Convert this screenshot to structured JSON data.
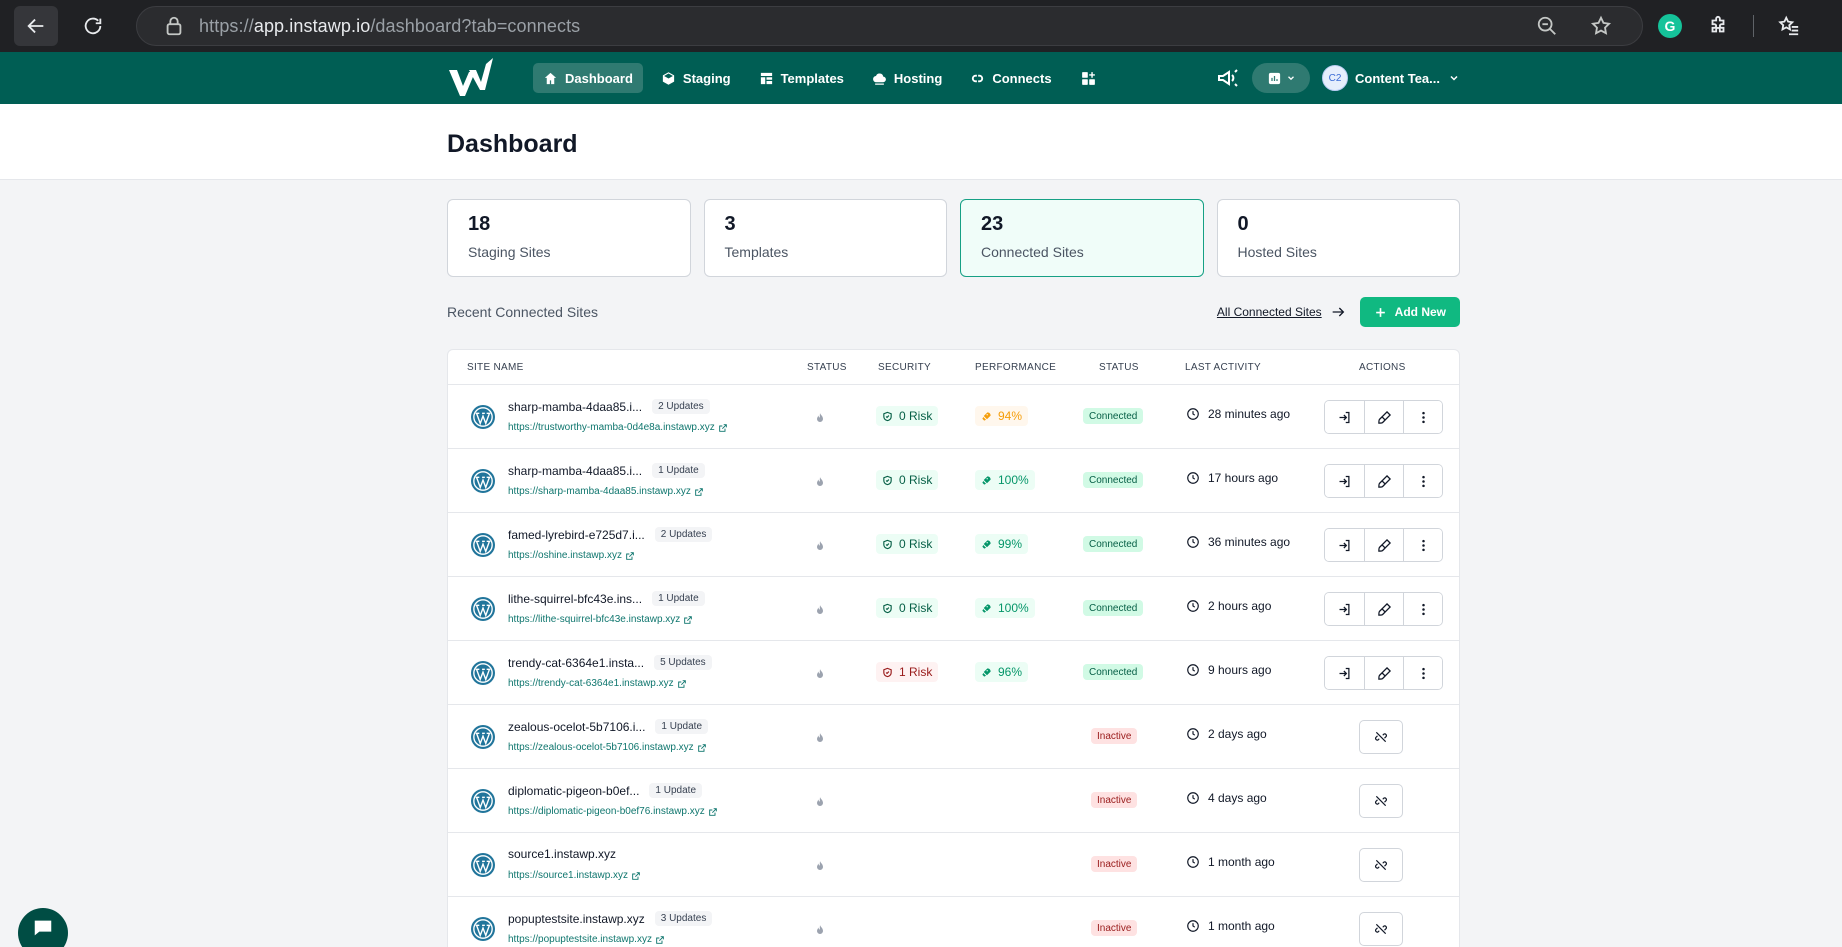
{
  "browser": {
    "url_prefix": "https://",
    "url_host": "app.instawp.io",
    "url_path": "/dashboard?tab=connects",
    "grammarly_letter": "G"
  },
  "nav": {
    "items": [
      {
        "label": "Dashboard",
        "icon": "home-icon",
        "active": true
      },
      {
        "label": "Staging",
        "icon": "cube-icon"
      },
      {
        "label": "Templates",
        "icon": "template-icon"
      },
      {
        "label": "Hosting",
        "icon": "cloud-icon"
      },
      {
        "label": "Connects",
        "icon": "link-icon"
      }
    ],
    "user_initials": "C2",
    "user_name": "Content Tea..."
  },
  "page": {
    "title": "Dashboard"
  },
  "stats": [
    {
      "value": "18",
      "label": "Staging Sites"
    },
    {
      "value": "3",
      "label": "Templates"
    },
    {
      "value": "23",
      "label": "Connected Sites",
      "active": true
    },
    {
      "value": "0",
      "label": "Hosted Sites"
    }
  ],
  "section": {
    "title": "Recent Connected Sites",
    "all_link": "All Connected Sites",
    "add_label": "Add New"
  },
  "table": {
    "headers": [
      "SITE NAME",
      "STATUS",
      "SECURITY",
      "PERFORMANCE",
      "STATUS",
      "LAST ACTIVITY",
      "ACTIONS"
    ],
    "rows": [
      {
        "name": "sharp-mamba-4daa85.i...",
        "updates": "2 Updates",
        "url": "https://trustworthy-mamba-0d4e8a.instawp.xyz",
        "security": "0 Risk",
        "perf": "94%",
        "state": "Connected",
        "activity": "28 minutes ago"
      },
      {
        "name": "sharp-mamba-4daa85.i...",
        "updates": "1 Update",
        "url": "https://sharp-mamba-4daa85.instawp.xyz",
        "security": "0 Risk",
        "perf": "100%",
        "state": "Connected",
        "activity": "17 hours ago"
      },
      {
        "name": "famed-lyrebird-e725d7.i...",
        "updates": "2 Updates",
        "url": "https://oshine.instawp.xyz",
        "security": "0 Risk",
        "perf": "99%",
        "state": "Connected",
        "activity": "36 minutes ago"
      },
      {
        "name": "lithe-squirrel-bfc43e.ins...",
        "updates": "1 Update",
        "url": "https://lithe-squirrel-bfc43e.instawp.xyz",
        "security": "0 Risk",
        "perf": "100%",
        "state": "Connected",
        "activity": "2 hours ago"
      },
      {
        "name": "trendy-cat-6364e1.insta...",
        "updates": "5 Updates",
        "url": "https://trendy-cat-6364e1.instawp.xyz",
        "security": "1 Risk",
        "perf": "96%",
        "state": "Connected",
        "activity": "9 hours ago"
      },
      {
        "name": "zealous-ocelot-5b7106.i...",
        "updates": "1 Update",
        "url": "https://zealous-ocelot-5b7106.instawp.xyz",
        "security": "",
        "perf": "",
        "state": "Inactive",
        "activity": "2 days ago"
      },
      {
        "name": "diplomatic-pigeon-b0ef...",
        "updates": "1 Update",
        "url": "https://diplomatic-pigeon-b0ef76.instawp.xyz",
        "security": "",
        "perf": "",
        "state": "Inactive",
        "activity": "4 days ago"
      },
      {
        "name": "source1.instawp.xyz",
        "updates": "",
        "url": "https://source1.instawp.xyz",
        "security": "",
        "perf": "",
        "state": "Inactive",
        "activity": "1 month ago"
      },
      {
        "name": "popuptestsite.instawp.xyz",
        "updates": "3 Updates",
        "url": "https://popuptestsite.instawp.xyz",
        "security": "",
        "perf": "",
        "state": "Inactive",
        "activity": "1 month ago"
      }
    ]
  }
}
